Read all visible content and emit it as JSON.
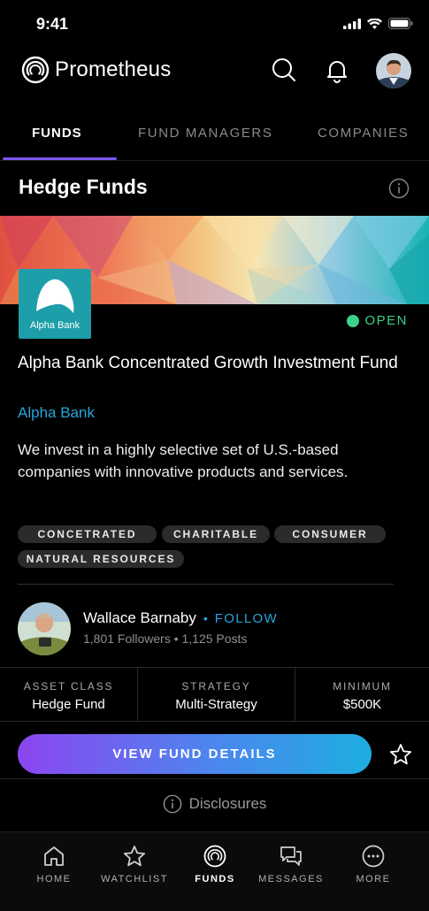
{
  "status_bar": {
    "time": "9:41"
  },
  "app": {
    "brand": "Prometheus"
  },
  "tabs": [
    {
      "label": "FUNDS",
      "active": true
    },
    {
      "label": "FUND MANAGERS",
      "active": false
    },
    {
      "label": "COMPANIES",
      "active": false
    }
  ],
  "section": {
    "title": "Hedge Funds"
  },
  "fund": {
    "logo_text": "Alpha Bank",
    "status": "OPEN",
    "status_color": "#3bd18a",
    "name": "Alpha Bank Concentrated Growth Investment Fund",
    "manager_link": "Alpha Bank",
    "description": "We invest in a highly selective set of U.S.-based companies with innovative products and services.",
    "tags": [
      "CONCETRATED",
      "CHARITABLE",
      "CONSUMER",
      "NATURAL RESOURCES"
    ]
  },
  "manager": {
    "name": "Wallace Barnaby",
    "separator": "•",
    "follow_label": "FOLLOW",
    "stats": "1,801 Followers • 1,125 Posts"
  },
  "stats": [
    {
      "label": "ASSET CLASS",
      "value": "Hedge Fund"
    },
    {
      "label": "STRATEGY",
      "value": "Multi-Strategy"
    },
    {
      "label": "MINIMUM",
      "value": "$500K"
    }
  ],
  "cta": {
    "label": "VIEW FUND DETAILS"
  },
  "disclosures": {
    "label": "Disclosures"
  },
  "bottom_nav": [
    {
      "label": "HOME",
      "icon": "home-icon",
      "active": false
    },
    {
      "label": "WATCHLIST",
      "icon": "star-icon",
      "active": false
    },
    {
      "label": "FUNDS",
      "icon": "funds-icon",
      "active": true
    },
    {
      "label": "MESSAGES",
      "icon": "messages-icon",
      "active": false
    },
    {
      "label": "MORE",
      "icon": "more-icon",
      "active": false
    }
  ],
  "colors": {
    "accent_link": "#26a5dd",
    "tab_underline": "#7b55f2",
    "cta_gradient": [
      "#8c45f0",
      "#4c86ee",
      "#1eaee0"
    ]
  }
}
